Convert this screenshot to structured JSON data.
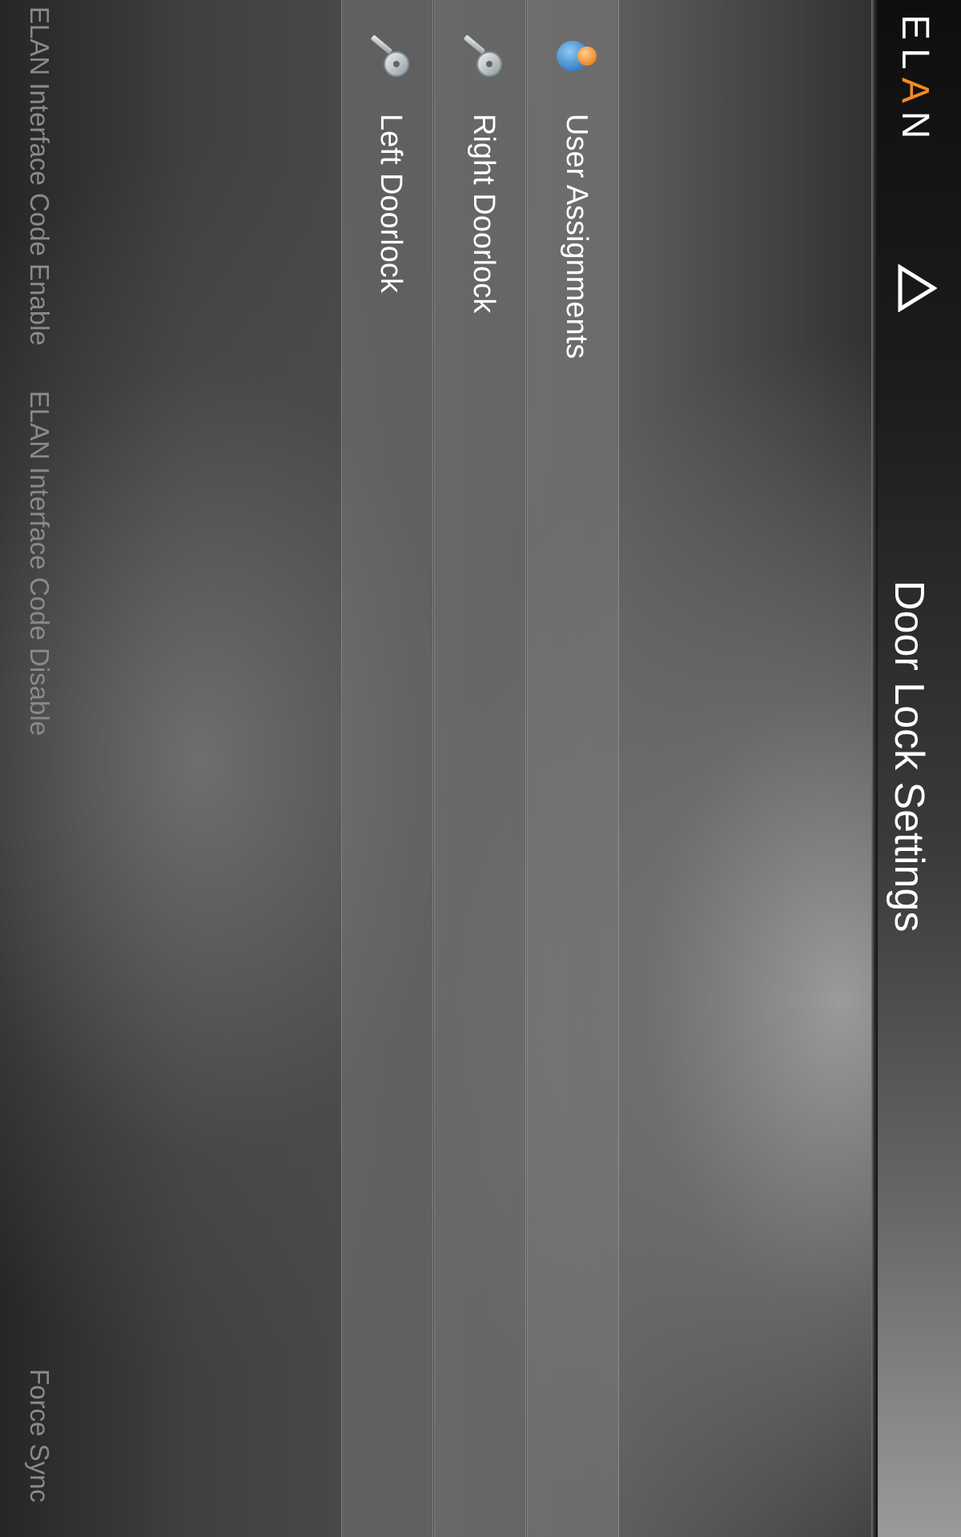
{
  "header": {
    "logo_prefix": "EL",
    "logo_accent": "A",
    "logo_suffix": "N",
    "title": "Door Lock Settings"
  },
  "list": {
    "items": [
      {
        "label": "User Assignments",
        "icon": "user-group-icon"
      },
      {
        "label": "Right Doorlock",
        "icon": "key-icon"
      },
      {
        "label": "Left Doorlock",
        "icon": "key-icon"
      }
    ]
  },
  "footer": {
    "enable_label": "ELAN Interface Code Enable",
    "disable_label": "ELAN Interface Code Disable",
    "force_sync_label": "Force Sync"
  },
  "colors": {
    "accent": "#f08a24",
    "text_primary": "#ffffff",
    "text_muted": "#8a8a8a"
  }
}
